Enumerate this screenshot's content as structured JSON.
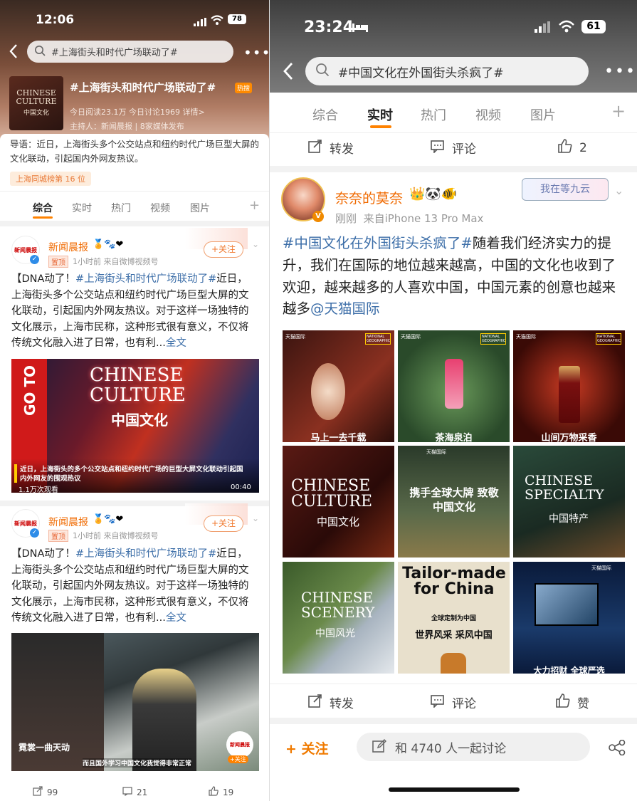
{
  "left": {
    "status": {
      "time": "12:06",
      "battery": "78"
    },
    "search": {
      "query": "#上海街头和时代广场联动了#"
    },
    "topic": {
      "title": "#上海街头和时代广场联动了#",
      "hot_badge": "热搜",
      "cover_en": "CHINESE CULTURE",
      "cover_cn": "中国文化",
      "stats": "今日阅读23.1万  今日讨论1969  详情>",
      "host": "主持人：新闻晨报 | 8家媒体发布",
      "intro": "导语：近日，上海街头多个公交站点和纽约时代广场巨型大屏的文化联动，引起国内外网友热议。",
      "rank": "上海同城榜第 16 位"
    },
    "tabs": [
      "综合",
      "实时",
      "热门",
      "视频",
      "图片"
    ],
    "tab_plus": "+",
    "posts": [
      {
        "author": "新闻晨报",
        "avatar_text": "新闻晨报",
        "pin": "置顶",
        "meta_time": "1小时前",
        "meta_src": "来自微博视频号",
        "follow": "+关注",
        "text_a": "【DNA动了！",
        "text_link": "#上海街头和时代广场联动了#",
        "text_b": "近日，上海街头多个公交站点和纽约时代广场巨型大屏的文化联动，引起国内外网友热议。对于这样一场独特的文化展示，上海市民称，这种形式很有意义，不仅将传统文化融入进了日常，也有利...",
        "more": "全文",
        "video_en1": "CHINESE",
        "video_en2": "CULTURE",
        "video_cn": "中国文化",
        "side_text": "GO TO",
        "caption": "近日，上海街头的多个公交站点和纽约时代广场的巨型大屏文化联动引起国内外网友的围观热议",
        "views": "1.1万次观看",
        "duration": "00:40"
      },
      {
        "author": "新闻晨报",
        "avatar_text": "新闻晨报",
        "pin": "置顶",
        "meta_time": "1小时前",
        "meta_src": "来自微博视频号",
        "follow": "+关注",
        "text_a": "【DNA动了！",
        "text_link": "#上海街头和时代广场联动了#",
        "text_b": "近日，上海街头多个公交站点和纽约时代广场巨型大屏的文化联动，引起国内外网友热议。对于这样一场独特的文化展示，上海市民称，这种形式很有意义，不仅将传统文化融入进了日常，也有利...",
        "more": "全文",
        "video_sub1": "霓裳一曲天动",
        "video_sub2": "而且国外学习中国文化我觉得非常正常",
        "follow_small": "+关注"
      }
    ],
    "actions": {
      "repost": "99",
      "comment": "21",
      "like": "19"
    }
  },
  "right": {
    "status": {
      "time": "23:24",
      "battery": "61"
    },
    "search": {
      "query": "#中国文化在外国街头杀疯了#"
    },
    "tabs": [
      "综合",
      "实时",
      "热门",
      "视频",
      "图片"
    ],
    "tab_plus": "+",
    "prev_actions": {
      "repost": "转发",
      "comment": "评论",
      "like": "2"
    },
    "post": {
      "author": "奈奈的莫奈",
      "time": "刚刚",
      "source": "来自iPhone 13 Pro Max",
      "sticker": "我在等九云",
      "text_link1": "#中国文化在外国街头杀疯了#",
      "text": "随着我们经济实力的提升，我们在国际的地位越来越高，中国的文化也收到了欢迎，越来越多的人喜欢中国，中国元素的创意也越来越多",
      "text_link2": "@天猫国际",
      "grid": [
        {
          "brand": "天猫国际",
          "ng": "NATIONAL GEOGRAPHIC",
          "cn": "马上一去千载"
        },
        {
          "brand": "天猫国际",
          "ng": "NATIONAL GEOGRAPHIC",
          "cn": "茶海泉泊"
        },
        {
          "brand": "天猫国际",
          "ng": "NATIONAL GEOGRAPHIC",
          "cn": "山间万物采香"
        },
        {
          "en": "CHINESE CULTURE",
          "cn": "中国文化"
        },
        {
          "brand": "天猫国际",
          "cn": "携手全球大牌 致敬中国文化"
        },
        {
          "en": "CHINESE SPECIALTY",
          "cn": "中国特产"
        },
        {
          "en": "CHINESE SCENERY",
          "cn": "中国风光"
        },
        {
          "en": "Tailor-made for China",
          "sub": "全球定制为中国",
          "cn": "世界风采 采风中国"
        },
        {
          "brand": "天猫国际",
          "cn": "大力招财 全球严选"
        }
      ],
      "actions": {
        "repost": "转发",
        "comment": "评论",
        "like": "赞"
      }
    },
    "bottom": {
      "follow": "+ 关注",
      "discuss": "和 4740 人一起讨论"
    }
  }
}
